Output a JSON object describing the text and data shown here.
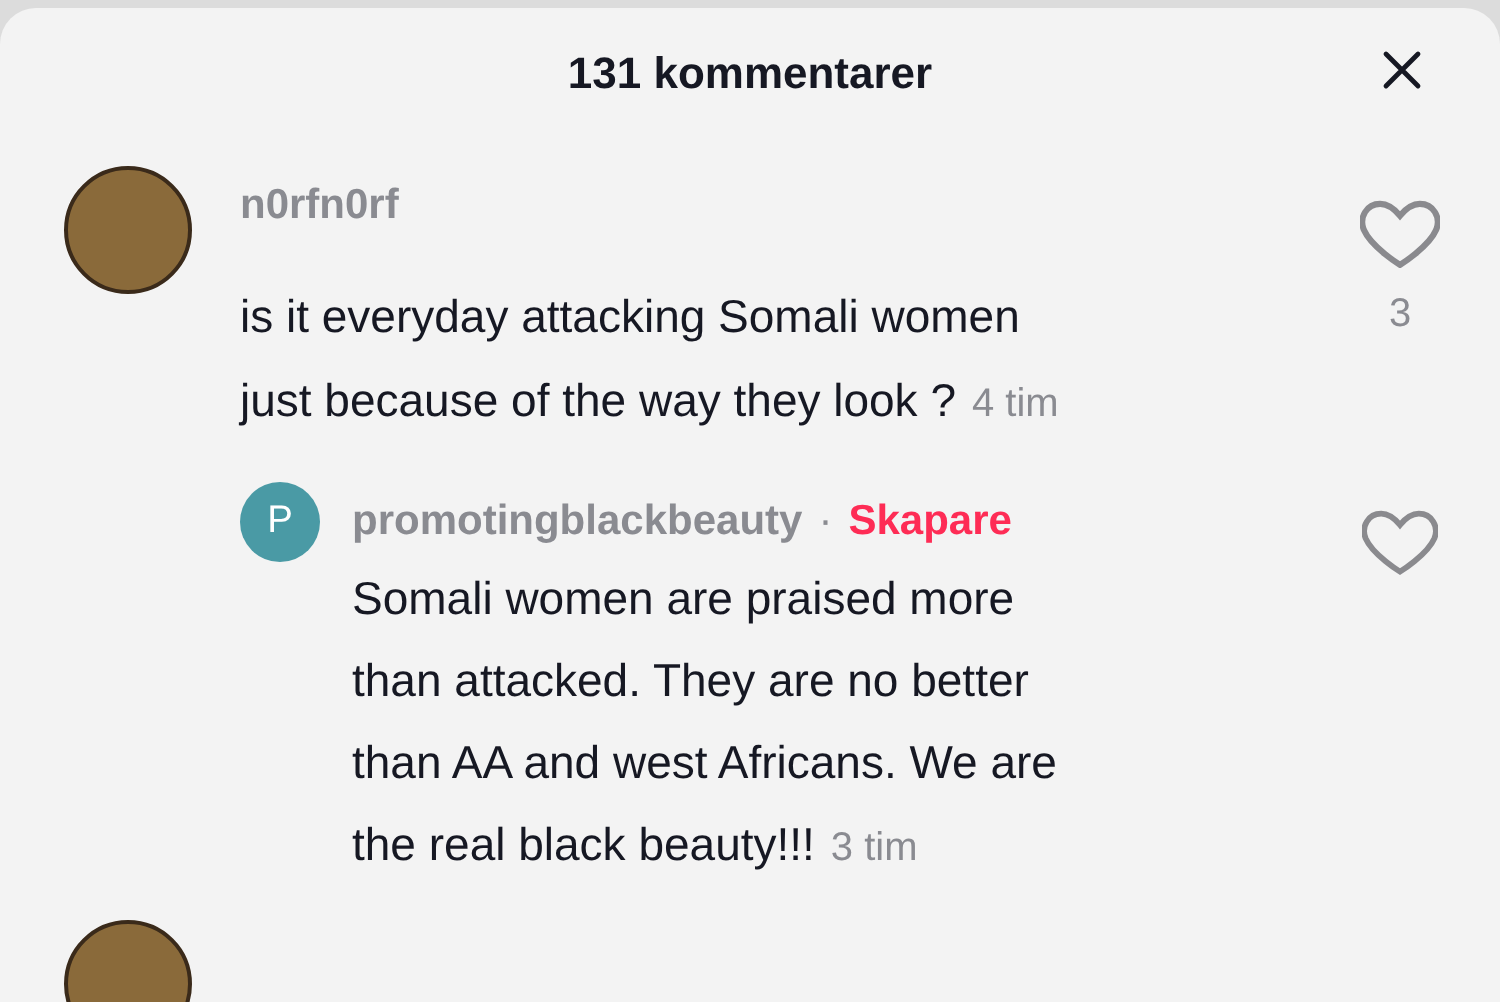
{
  "header": {
    "title": "131 kommentarer"
  },
  "comments": [
    {
      "username": "n0rfn0rf",
      "avatar": {
        "kind": "photo"
      },
      "text_lines": [
        "is it everyday attacking Somali women",
        "just because of the way they look ?"
      ],
      "time": "4 tim",
      "liked": false,
      "like_count": "3",
      "replies": [
        {
          "username": "promotingblackbeauty",
          "separator": "·",
          "creator_badge": "Skapare",
          "avatar": {
            "kind": "letter",
            "letter": "P",
            "color": "#4a9aa5"
          },
          "text_lines": [
            "Somali women are praised more",
            "than attacked. They are no better",
            "than AA and west Africans. We are",
            "the real black beauty!!!"
          ],
          "time": "3 tim",
          "liked": false
        }
      ]
    },
    {
      "avatar": {
        "kind": "photo"
      }
    }
  ]
}
